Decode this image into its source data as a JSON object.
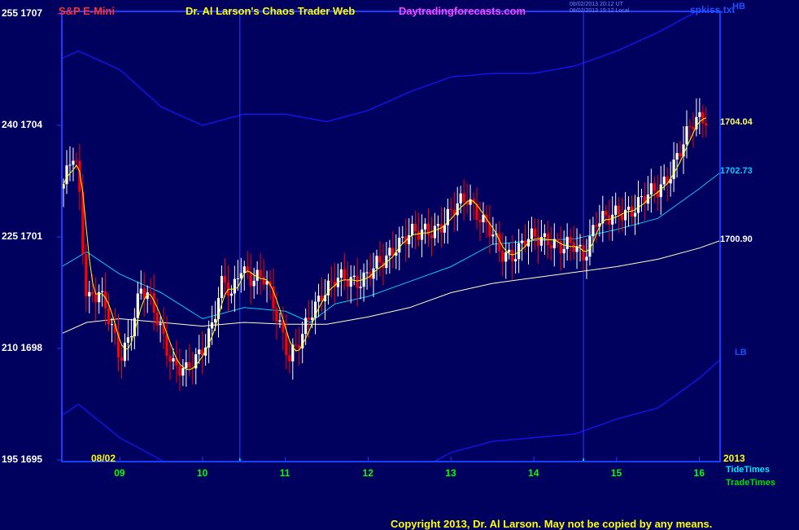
{
  "header": {
    "instrument": "S&P E-Mini",
    "site_title": "Dr. Al Larson's Chaos Trader Web",
    "site_url": "Daytradingforecasts.com",
    "stamp_line1": "08/02/2013 20:12 UT",
    "stamp_line2": "08/02/2013 15:12 Local",
    "file_name": "spkiss.txt"
  },
  "footer": {
    "copyright": "Copyright 2013, Dr. Al Larson. May not be copied by any means."
  },
  "colors": {
    "background": "#00005e",
    "frame": "#1e3cff",
    "bull_candle": "#ffffff",
    "bear_candle": "#ff0000",
    "ma_fast": "#ffff00",
    "ma_mid": "#00ccff",
    "ma_slow": "#ffffcc",
    "band": "#1414e6",
    "tide": "#00e5ff",
    "trade": "#00e000",
    "instrument": "#ff3030",
    "site_title": "#ffff00",
    "site_url": "#ff44ff",
    "copyright": "#ffff00",
    "x_labels": "#00ff00"
  },
  "chart_data": {
    "type": "candlestick",
    "date_label": "08/02",
    "year_label": "2013",
    "x_tick_labels": [
      "09",
      "10",
      "11",
      "12",
      "13",
      "14",
      "15",
      "16"
    ],
    "y_tick_labels": [
      {
        "left": "255",
        "right": "1707",
        "price": 1707
      },
      {
        "left": "240",
        "right": "1704",
        "price": 1704
      },
      {
        "left": "225",
        "right": "1701",
        "price": 1701
      },
      {
        "left": "210",
        "right": "1698",
        "price": 1698
      },
      {
        "left": "195",
        "right": "1695",
        "price": 1695
      }
    ],
    "x_range_hours": [
      8.3,
      16.25
    ],
    "y_range": [
      1695,
      1707
    ],
    "price_labels": [
      {
        "label": "1704.04",
        "price": 1704.04,
        "color": "#ffff66",
        "series": "close"
      },
      {
        "label": "1702.73",
        "price": 1702.73,
        "color": "#00ccff",
        "series": "ma_mid"
      },
      {
        "label": "1700.90",
        "price": 1700.9,
        "color": "#ffffff",
        "series": "ma_slow"
      }
    ],
    "band_labels": {
      "upper": "HB",
      "lower": "LB"
    },
    "timing_series": [
      {
        "name": "TideTimes",
        "level": 1694.7,
        "spikes": [
          10.45,
          14.6
        ]
      },
      {
        "name": "TradeTimes",
        "level": 1694.35,
        "spikes": [
          10.45,
          14.6
        ]
      }
    ],
    "vertical_markers_hours": [
      10.45,
      14.6
    ],
    "price_path": [
      [
        8.3,
        1702.3
      ],
      [
        8.45,
        1703.2
      ],
      [
        8.5,
        1702.5
      ],
      [
        8.55,
        1700.8
      ],
      [
        8.6,
        1699.4
      ],
      [
        8.75,
        1699.6
      ],
      [
        8.9,
        1698.5
      ],
      [
        9.0,
        1697.7
      ],
      [
        9.1,
        1698.3
      ],
      [
        9.25,
        1699.6
      ],
      [
        9.35,
        1699.3
      ],
      [
        9.5,
        1698.5
      ],
      [
        9.65,
        1697.6
      ],
      [
        9.8,
        1697.3
      ],
      [
        9.95,
        1697.8
      ],
      [
        10.1,
        1698.6
      ],
      [
        10.25,
        1699.8
      ],
      [
        10.35,
        1699.3
      ],
      [
        10.45,
        1700.3
      ],
      [
        10.6,
        1699.9
      ],
      [
        10.75,
        1699.8
      ],
      [
        10.85,
        1699.2
      ],
      [
        10.95,
        1698.6
      ],
      [
        11.05,
        1697.8
      ],
      [
        11.2,
        1698.2
      ],
      [
        11.3,
        1698.9
      ],
      [
        11.45,
        1699.6
      ],
      [
        11.6,
        1699.8
      ],
      [
        11.75,
        1699.8
      ],
      [
        11.9,
        1699.9
      ],
      [
        12.05,
        1700.1
      ],
      [
        12.2,
        1700.3
      ],
      [
        12.35,
        1700.9
      ],
      [
        12.5,
        1701.1
      ],
      [
        12.6,
        1701.0
      ],
      [
        12.75,
        1701.2
      ],
      [
        12.9,
        1701.4
      ],
      [
        13.05,
        1701.7
      ],
      [
        13.2,
        1702.1
      ],
      [
        13.35,
        1701.6
      ],
      [
        13.5,
        1701.0
      ],
      [
        13.6,
        1700.5
      ],
      [
        13.75,
        1700.6
      ],
      [
        13.9,
        1700.9
      ],
      [
        14.05,
        1700.9
      ],
      [
        14.2,
        1701.0
      ],
      [
        14.35,
        1700.7
      ],
      [
        14.5,
        1700.7
      ],
      [
        14.6,
        1700.5
      ],
      [
        14.75,
        1701.5
      ],
      [
        14.9,
        1701.4
      ],
      [
        15.05,
        1701.7
      ],
      [
        15.2,
        1701.8
      ],
      [
        15.35,
        1702.0
      ],
      [
        15.5,
        1702.3
      ],
      [
        15.65,
        1702.8
      ],
      [
        15.8,
        1703.4
      ],
      [
        15.95,
        1704.2
      ],
      [
        16.1,
        1704.3
      ],
      [
        16.15,
        1704.04
      ]
    ],
    "ma_slow_path": [
      [
        8.3,
        1698.4
      ],
      [
        8.6,
        1698.7
      ],
      [
        9.0,
        1698.8
      ],
      [
        9.5,
        1698.7
      ],
      [
        10.0,
        1698.6
      ],
      [
        10.5,
        1698.7
      ],
      [
        11.0,
        1698.65
      ],
      [
        11.5,
        1698.65
      ],
      [
        12.0,
        1698.85
      ],
      [
        12.5,
        1699.1
      ],
      [
        13.0,
        1699.5
      ],
      [
        13.5,
        1699.75
      ],
      [
        14.0,
        1699.9
      ],
      [
        14.5,
        1700.05
      ],
      [
        15.0,
        1700.2
      ],
      [
        15.5,
        1700.4
      ],
      [
        16.0,
        1700.7
      ],
      [
        16.25,
        1700.9
      ]
    ],
    "ma_mid_path": [
      [
        8.3,
        1700.2
      ],
      [
        8.6,
        1700.6
      ],
      [
        9.0,
        1700.0
      ],
      [
        9.5,
        1699.5
      ],
      [
        10.0,
        1698.8
      ],
      [
        10.5,
        1699.1
      ],
      [
        11.0,
        1699.0
      ],
      [
        11.3,
        1698.7
      ],
      [
        11.6,
        1699.2
      ],
      [
        12.0,
        1699.4
      ],
      [
        12.5,
        1699.8
      ],
      [
        13.0,
        1700.2
      ],
      [
        13.5,
        1700.8
      ],
      [
        14.0,
        1700.9
      ],
      [
        14.5,
        1700.95
      ],
      [
        15.0,
        1701.2
      ],
      [
        15.5,
        1701.5
      ],
      [
        16.0,
        1702.3
      ],
      [
        16.25,
        1702.73
      ]
    ],
    "band_upper_path": [
      [
        8.3,
        1705.8
      ],
      [
        8.5,
        1706.0
      ],
      [
        9.0,
        1705.5
      ],
      [
        9.5,
        1704.5
      ],
      [
        10.0,
        1704.0
      ],
      [
        10.5,
        1704.3
      ],
      [
        11.0,
        1704.3
      ],
      [
        11.5,
        1704.1
      ],
      [
        12.0,
        1704.4
      ],
      [
        12.5,
        1704.9
      ],
      [
        13.0,
        1705.3
      ],
      [
        13.5,
        1705.4
      ],
      [
        14.0,
        1705.4
      ],
      [
        14.5,
        1705.6
      ],
      [
        15.0,
        1706.0
      ],
      [
        15.5,
        1706.5
      ],
      [
        16.0,
        1707.1
      ],
      [
        16.25,
        1707.5
      ]
    ],
    "band_lower_path": [
      [
        8.3,
        1696.2
      ],
      [
        8.5,
        1696.5
      ],
      [
        9.0,
        1695.6
      ],
      [
        9.5,
        1695.0
      ],
      [
        10.0,
        1694.4
      ],
      [
        10.5,
        1694.1
      ],
      [
        11.0,
        1694.5
      ],
      [
        11.5,
        1694.4
      ],
      [
        12.0,
        1694.4
      ],
      [
        12.5,
        1694.6
      ],
      [
        13.0,
        1695.2
      ],
      [
        13.5,
        1695.5
      ],
      [
        14.0,
        1695.6
      ],
      [
        14.5,
        1695.7
      ],
      [
        15.0,
        1696.1
      ],
      [
        15.5,
        1696.4
      ],
      [
        16.0,
        1697.2
      ],
      [
        16.25,
        1697.7
      ]
    ]
  }
}
